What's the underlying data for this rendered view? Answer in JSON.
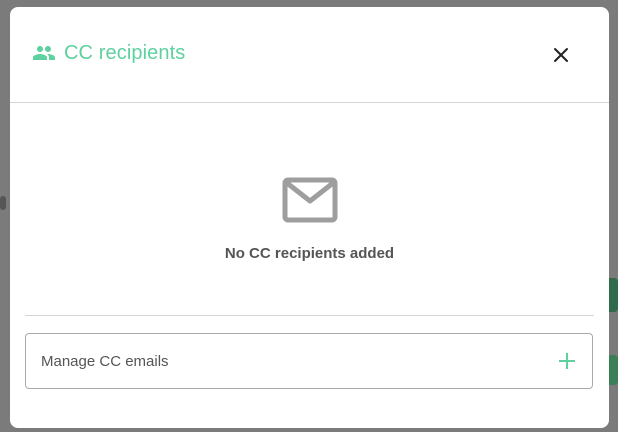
{
  "modal": {
    "title": "CC recipients",
    "title_icon": "group-icon",
    "close_icon": "close-icon",
    "empty_icon": "mail-icon",
    "empty_message": "No CC recipients added",
    "manage_label": "Manage CC emails",
    "manage_icon": "plus-icon"
  },
  "colors": {
    "accent": "#5fd0a0",
    "muted_text": "#555555",
    "icon_gray": "#9e9e9e",
    "border": "#d5d5d5",
    "overlay": "#7b7b7b"
  }
}
